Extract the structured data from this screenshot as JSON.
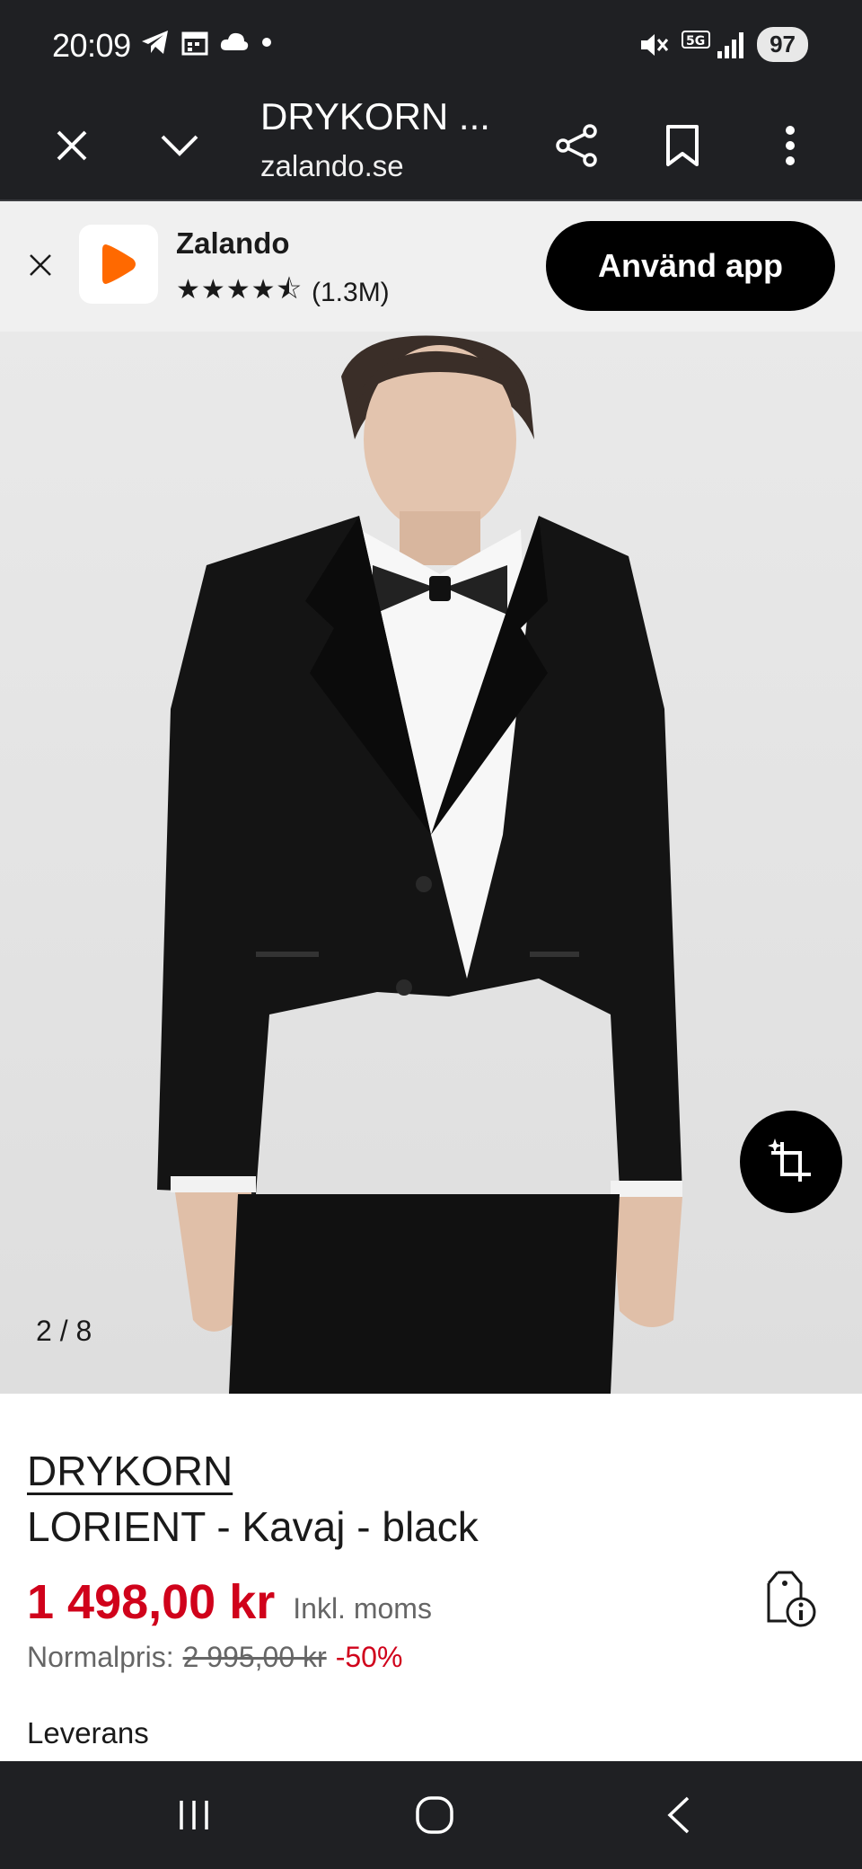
{
  "status_bar": {
    "time": "20:09",
    "battery": "97"
  },
  "toolbar": {
    "title": "DRYKORN ...",
    "url": "zalando.se"
  },
  "app_banner": {
    "app_name": "Zalando",
    "stars": "★★★★⯪",
    "rating_count": "(1.3M)",
    "cta_label": "Använd app"
  },
  "gallery": {
    "counter": "2 / 8"
  },
  "product": {
    "brand": "DRYKORN",
    "title": "LORIENT - Kavaj - black",
    "price": "1 498,00 kr",
    "vat_label": "Inkl. moms",
    "normal_price_label": "Normalpris:",
    "normal_price": "2 995,00 kr",
    "discount": "-50%",
    "delivery_label": "Leverans"
  },
  "colors": {
    "brand_orange": "#ff6900",
    "sale_red": "#d0021b",
    "dark_bg": "#1f2023"
  }
}
